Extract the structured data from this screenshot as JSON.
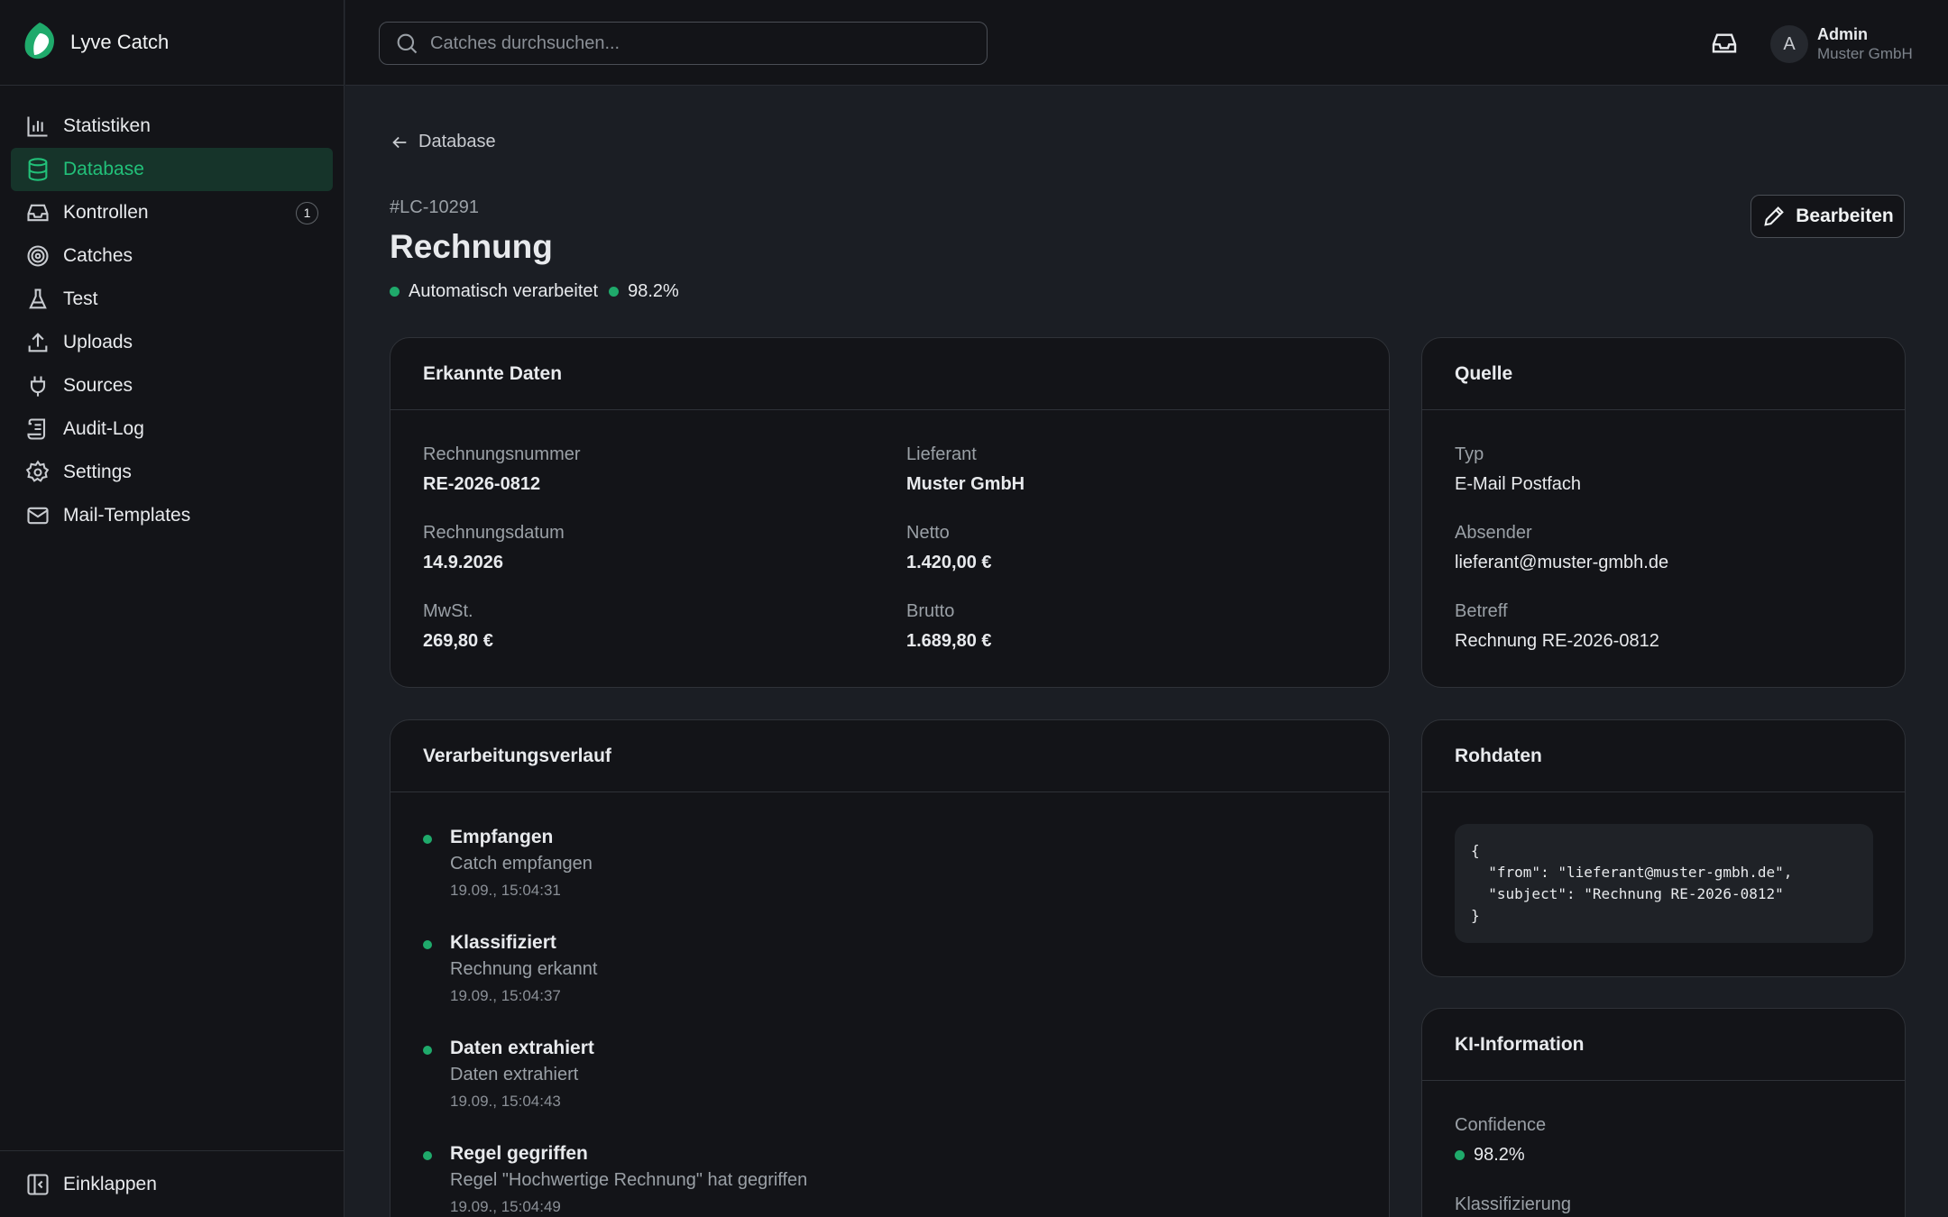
{
  "brand": {
    "name": "Lyve Catch"
  },
  "sidebar": {
    "items": [
      {
        "label": "Statistiken",
        "icon": "bar-chart-icon"
      },
      {
        "label": "Database",
        "icon": "database-icon",
        "active": true
      },
      {
        "label": "Kontrollen",
        "icon": "inbox-icon",
        "badge": "1"
      },
      {
        "label": "Catches",
        "icon": "target-icon"
      },
      {
        "label": "Test",
        "icon": "flask-icon"
      },
      {
        "label": "Uploads",
        "icon": "upload-icon"
      },
      {
        "label": "Sources",
        "icon": "plug-icon"
      },
      {
        "label": "Audit-Log",
        "icon": "scroll-icon"
      },
      {
        "label": "Settings",
        "icon": "gear-icon"
      },
      {
        "label": "Mail-Templates",
        "icon": "mail-icon"
      }
    ],
    "collapse_label": "Einklappen"
  },
  "topbar": {
    "search_placeholder": "Catches durchsuchen...",
    "user": {
      "initial": "A",
      "name": "Admin",
      "org": "Muster GmbH"
    }
  },
  "page": {
    "back_label": "Database",
    "doc_id": "#LC-10291",
    "title": "Rechnung",
    "status": "Automatisch verarbeitet",
    "confidence": "98.2%",
    "edit_label": "Bearbeiten"
  },
  "recognized": {
    "title": "Erkannte Daten",
    "fields": [
      {
        "label": "Rechnungsnummer",
        "value": "RE-2026-0812"
      },
      {
        "label": "Lieferant",
        "value": "Muster GmbH"
      },
      {
        "label": "Rechnungsdatum",
        "value": "14.9.2026"
      },
      {
        "label": "Netto",
        "value": "1.420,00 €"
      },
      {
        "label": "MwSt.",
        "value": "269,80 €"
      },
      {
        "label": "Brutto",
        "value": "1.689,80 €"
      }
    ]
  },
  "source": {
    "title": "Quelle",
    "fields": [
      {
        "label": "Typ",
        "value": "E-Mail Postfach"
      },
      {
        "label": "Absender",
        "value": "lieferant@muster-gmbh.de"
      },
      {
        "label": "Betreff",
        "value": "Rechnung RE-2026-0812"
      }
    ]
  },
  "history": {
    "title": "Verarbeitungsverlauf",
    "items": [
      {
        "title": "Empfangen",
        "desc": "Catch empfangen",
        "time": "19.09., 15:04:31"
      },
      {
        "title": "Klassifiziert",
        "desc": "Rechnung erkannt",
        "time": "19.09., 15:04:37"
      },
      {
        "title": "Daten extrahiert",
        "desc": "Daten extrahiert",
        "time": "19.09., 15:04:43"
      },
      {
        "title": "Regel gegriffen",
        "desc": "Regel \"Hochwertige Rechnung\" hat gegriffen",
        "time": "19.09., 15:04:49"
      }
    ]
  },
  "raw": {
    "title": "Rohdaten",
    "code": "{\n  \"from\": \"lieferant@muster-gmbh.de\",\n  \"subject\": \"Rechnung RE-2026-0812\"\n}"
  },
  "ai": {
    "title": "KI-Information",
    "confidence_label": "Confidence",
    "confidence_value": "98.2%",
    "classification_label": "Klassifizierung"
  },
  "colors": {
    "accent": "#22c079",
    "background": "#1b1e24",
    "panel": "#131418"
  }
}
